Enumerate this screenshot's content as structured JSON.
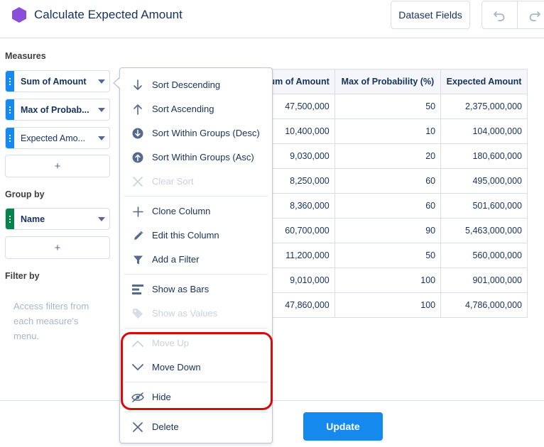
{
  "header": {
    "title": "Calculate Expected Amount",
    "dataset_fields_label": "Dataset Fields",
    "app_icon": "purple-hexagon-icon",
    "undo_icon": "undo-icon",
    "redo_icon": "redo-icon",
    "accent_color": "#8a4fd9"
  },
  "left_panel": {
    "measures_label": "Measures",
    "measures": [
      {
        "label": "Sum of Amount",
        "handle_color": "#1589ee"
      },
      {
        "label": "Max of Probab...",
        "handle_color": "#1589ee"
      },
      {
        "label": "Expected Amo...",
        "handle_color": "#1589ee"
      }
    ],
    "add_label": "+",
    "group_by_label": "Group by",
    "groups": [
      {
        "label": "Name",
        "handle_color": "#04844b"
      }
    ],
    "filter_by_label": "Filter by",
    "filter_hint": "Access filters from each measure's menu."
  },
  "table": {
    "columns": [
      "um of Amount",
      "Max of Probability (%)",
      "Expected Amount"
    ],
    "rows": [
      [
        "47,500,000",
        "50",
        "2,375,000,000"
      ],
      [
        "10,400,000",
        "10",
        "104,000,000"
      ],
      [
        "9,030,000",
        "20",
        "180,600,000"
      ],
      [
        "8,250,000",
        "60",
        "495,000,000"
      ],
      [
        "8,360,000",
        "60",
        "501,600,000"
      ],
      [
        "60,700,000",
        "90",
        "5,463,000,000"
      ],
      [
        "11,200,000",
        "50",
        "560,000,000"
      ],
      [
        "9,010,000",
        "100",
        "901,000,000"
      ],
      [
        "47,860,000",
        "100",
        "4,786,000,000"
      ]
    ]
  },
  "menu": {
    "items": [
      {
        "label": "Sort Descending",
        "icon": "arrow-down-icon",
        "disabled": false
      },
      {
        "label": "Sort Ascending",
        "icon": "arrow-up-icon",
        "disabled": false
      },
      {
        "label": "Sort Within Groups (Desc)",
        "icon": "circle-arrow-down-icon",
        "disabled": false
      },
      {
        "label": "Sort Within Groups (Asc)",
        "icon": "circle-arrow-up-icon",
        "disabled": false
      },
      {
        "label": "Clear Sort",
        "icon": "close-icon",
        "disabled": true
      },
      {
        "label": "Clone Column",
        "icon": "plus-icon",
        "disabled": false
      },
      {
        "label": "Edit this Column",
        "icon": "pencil-icon",
        "disabled": false
      },
      {
        "label": "Add a Filter",
        "icon": "filter-icon",
        "disabled": false
      },
      {
        "label": "Show as Bars",
        "icon": "bars-icon",
        "disabled": false
      },
      {
        "label": "Show as Values",
        "icon": "tag-icon",
        "disabled": true
      },
      {
        "label": "Move Up",
        "icon": "chevron-up-icon",
        "disabled": true
      },
      {
        "label": "Move Down",
        "icon": "chevron-down-icon",
        "disabled": false
      },
      {
        "label": "Hide",
        "icon": "eye-slash-icon",
        "disabled": false
      },
      {
        "label": "Delete",
        "icon": "close-icon",
        "disabled": false
      }
    ],
    "highlight_color": "#d80b0b"
  },
  "footer": {
    "update_label": "Update",
    "update_color": "#1589ee"
  }
}
